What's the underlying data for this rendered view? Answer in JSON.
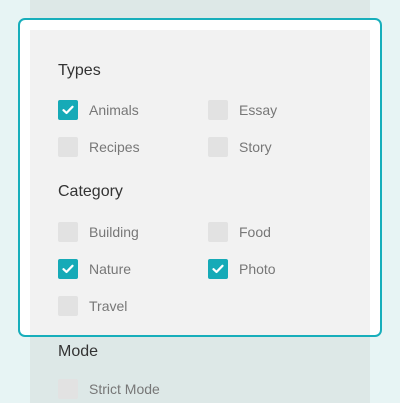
{
  "colors": {
    "accent": "#16aab7",
    "border": "#17aebb"
  },
  "popup": {
    "sections": [
      {
        "title": "Types",
        "options": [
          {
            "label": "Animals",
            "checked": true
          },
          {
            "label": "Essay",
            "checked": false
          },
          {
            "label": "Recipes",
            "checked": false
          },
          {
            "label": "Story",
            "checked": false
          }
        ]
      },
      {
        "title": "Category",
        "options": [
          {
            "label": "Building",
            "checked": false
          },
          {
            "label": "Food",
            "checked": false
          },
          {
            "label": "Nature",
            "checked": true
          },
          {
            "label": "Photo",
            "checked": true
          },
          {
            "label": "Travel",
            "checked": false
          }
        ]
      }
    ]
  },
  "background": {
    "mode_title": "Mode",
    "strict_mode_label": "Strict Mode",
    "strict_mode_checked": false
  }
}
